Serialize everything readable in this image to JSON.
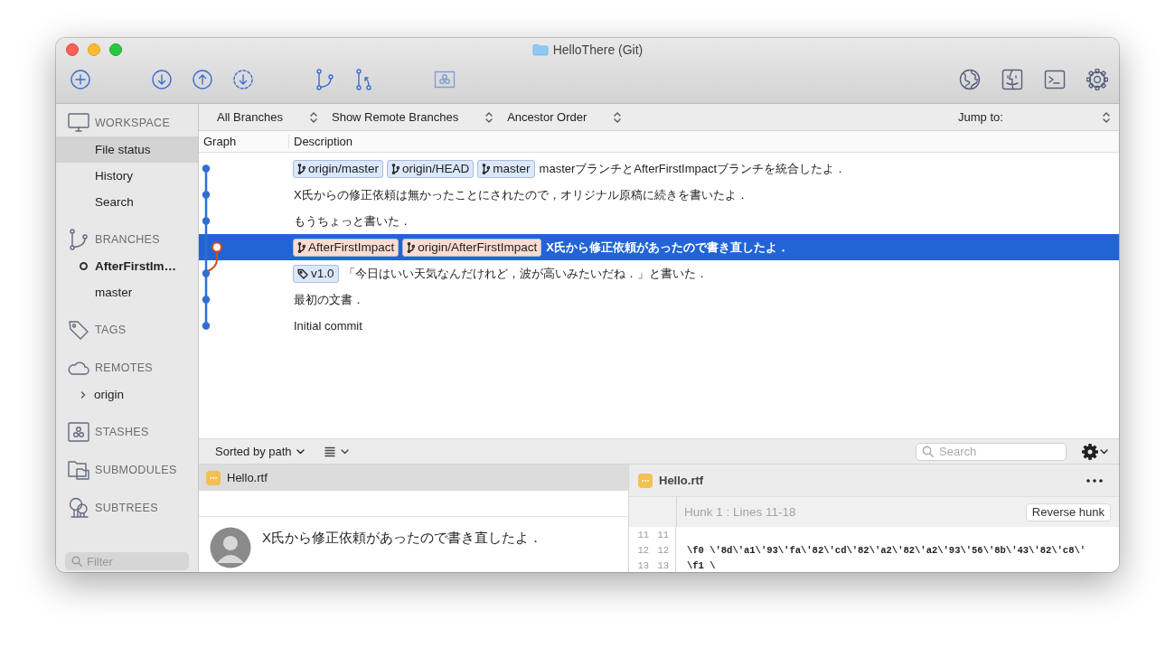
{
  "window": {
    "title": "HelloThere (Git)"
  },
  "sidebar": {
    "sections": [
      {
        "kind": "workspace",
        "title": "WORKSPACE",
        "items": [
          {
            "label": "File status",
            "selected": true
          },
          {
            "label": "History",
            "selected": false
          },
          {
            "label": "Search",
            "selected": false
          }
        ]
      },
      {
        "kind": "branches",
        "title": "BRANCHES",
        "items": [
          {
            "label": "AfterFirstIm…",
            "selected": false,
            "current": true
          },
          {
            "label": "master",
            "selected": false,
            "current": false
          }
        ]
      },
      {
        "kind": "tags",
        "title": "TAGS"
      },
      {
        "kind": "remotes",
        "title": "REMOTES",
        "items": [
          {
            "label": "origin",
            "selected": false,
            "expanded": false
          }
        ]
      },
      {
        "kind": "stashes",
        "title": "STASHES"
      },
      {
        "kind": "submodules",
        "title": "SUBMODULES"
      },
      {
        "kind": "subtrees",
        "title": "SUBTREES"
      }
    ],
    "filter": {
      "placeholder": "Filter"
    }
  },
  "history": {
    "filters": [
      "All Branches",
      "Show Remote Branches",
      "Ancestor Order"
    ],
    "jump": {
      "label": "Jump to:"
    },
    "columns": [
      "Graph",
      "Description"
    ],
    "rows": [
      {
        "on_branch": false,
        "selected": false,
        "refs": [
          {
            "kind": "branch",
            "label": "origin/master",
            "color": "#dbe7fb"
          },
          {
            "kind": "branch",
            "label": "origin/HEAD",
            "color": "#dbe7fb"
          },
          {
            "kind": "branch",
            "label": "master",
            "color": "#dbe7fb"
          }
        ],
        "message": "masterブランチとAfterFirstImpactブランチを統合したよ．"
      },
      {
        "on_branch": false,
        "selected": false,
        "message": "X氏からの修正依頼は無かったことにされたので，オリジナル原稿に続きを書いたよ．"
      },
      {
        "on_branch": false,
        "selected": false,
        "message": "もうちょっと書いた．"
      },
      {
        "on_branch": true,
        "selected": true,
        "refs": [
          {
            "kind": "branch",
            "label": "AfterFirstImpact",
            "color": "#fbdcd2"
          },
          {
            "kind": "branch",
            "label": "origin/AfterFirstImpact",
            "color": "#fbdcd2"
          }
        ],
        "message": "X氏から修正依頼があったので書き直したよ．"
      },
      {
        "on_branch": false,
        "selected": false,
        "refs": [
          {
            "kind": "tag",
            "label": "v1.0",
            "color": "#dbe7fb"
          }
        ],
        "message": "「今日はいい天気なんだけれど，波が高いみたいだね．」と書いた．"
      },
      {
        "on_branch": false,
        "selected": false,
        "message": "最初の文書．"
      },
      {
        "on_branch": false,
        "selected": false,
        "message": "Initial commit"
      }
    ]
  },
  "bottom": {
    "sort": "Sorted by path",
    "search": {
      "placeholder": "Search"
    },
    "files": [
      {
        "name": "Hello.rtf",
        "selected": true
      }
    ],
    "commit_message": "X氏から修正依頼があったので書き直したよ．",
    "diff": {
      "file": "Hello.rtf",
      "hunk": "Hunk 1 : Lines 11-18",
      "reverse_button": "Reverse hunk",
      "lines": [
        {
          "old": "11",
          "new": "11"
        },
        {
          "old": "12",
          "new": "12",
          "text": "\\f0 \\'8d\\'a1\\'93\\'fa\\'82\\'cd\\'82\\'a2\\'82\\'a2\\'93\\'56\\'8b\\'43\\'82\\'c8\\'"
        },
        {
          "old": "13",
          "new": "13",
          "text": "\\f1 \\"
        }
      ]
    }
  }
}
